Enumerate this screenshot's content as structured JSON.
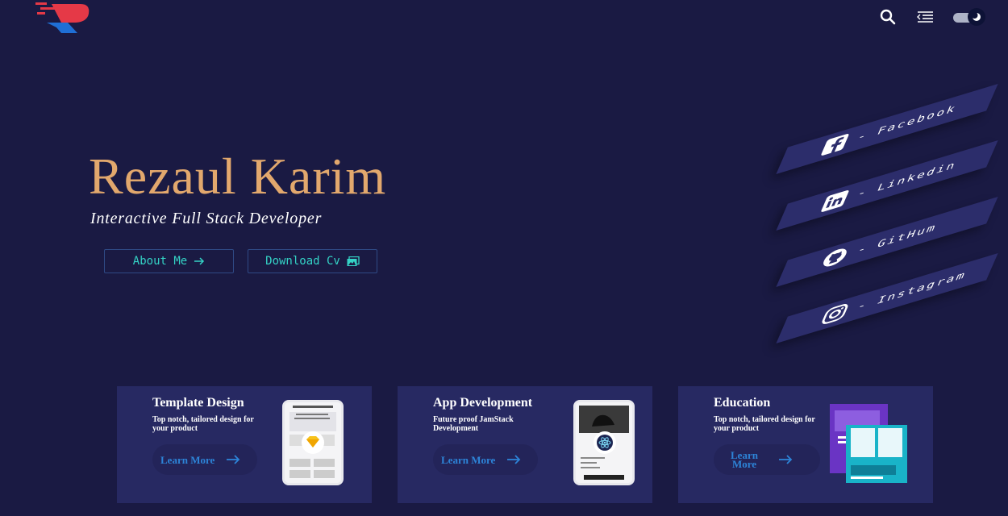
{
  "header": {
    "icons": [
      "logo",
      "search-icon",
      "menu-icon",
      "theme-toggle"
    ]
  },
  "hero": {
    "name": "Rezaul Karim",
    "subtitle": "Interactive Full Stack Developer",
    "buttons": {
      "about": "About Me",
      "cv": "Download Cv"
    }
  },
  "social": [
    {
      "label": "- Facebook",
      "icon": "facebook-icon"
    },
    {
      "label": "- Linkedin",
      "icon": "linkedin-icon"
    },
    {
      "label": "- GitHum",
      "icon": "github-icon"
    },
    {
      "label": "- Instagram",
      "icon": "instagram-icon"
    }
  ],
  "cards": [
    {
      "title": "Template Design",
      "desc": "Top notch, tailored design for your product",
      "link": "Learn More"
    },
    {
      "title": "App Development",
      "desc": "Future proof JamStack Development",
      "link": "Learn More"
    },
    {
      "title": "Education",
      "desc": "Top notch, tailored design for your product",
      "link": "Learn More"
    }
  ],
  "colors": {
    "background": "#1a1a43",
    "accent": "#e2a86d",
    "button_text": "#34d3c6",
    "card": "#272962",
    "link": "#2d84d8"
  }
}
